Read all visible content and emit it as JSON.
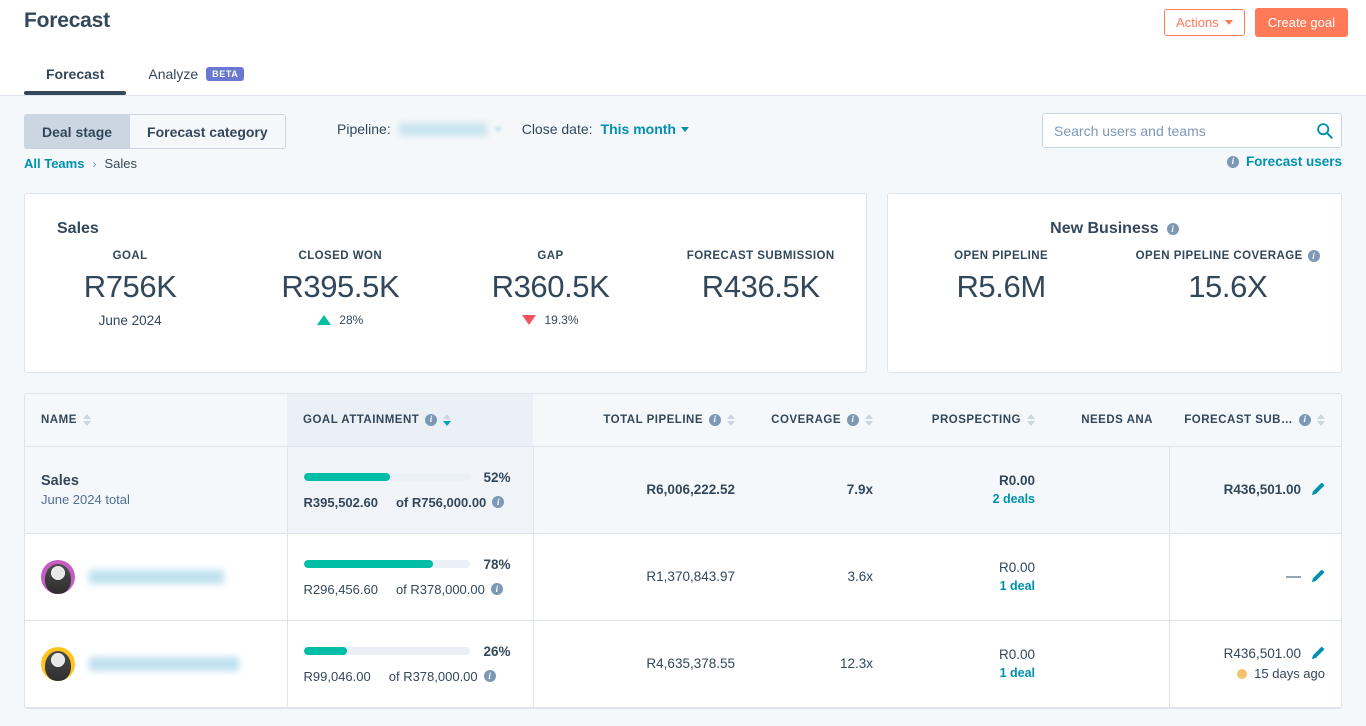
{
  "header": {
    "title": "Forecast",
    "actions_label": "Actions",
    "create_goal_label": "Create goal"
  },
  "tabs": [
    {
      "label": "Forecast",
      "active": true,
      "badge": null
    },
    {
      "label": "Analyze",
      "active": false,
      "badge": "BETA"
    }
  ],
  "filterbar": {
    "segments": [
      {
        "label": "Deal stage",
        "active": true
      },
      {
        "label": "Forecast category",
        "active": false
      }
    ],
    "pipeline_label": "Pipeline:",
    "pipeline_value": "",
    "close_date_label": "Close date:",
    "close_date_value": "This month",
    "search_placeholder": "Search users and teams",
    "search_value": ""
  },
  "breadcrumb": {
    "root": "All Teams",
    "separator": "›",
    "current": "Sales",
    "forecast_users_label": "Forecast users"
  },
  "cards": [
    {
      "title": "Sales",
      "has_info": false,
      "metrics": [
        {
          "label": "GOAL",
          "value": "R756K",
          "sub": "June 2024",
          "delta": null,
          "trend": null,
          "info": false
        },
        {
          "label": "CLOSED WON",
          "value": "R395.5K",
          "sub": null,
          "delta": "28%",
          "trend": "up",
          "info": false
        },
        {
          "label": "GAP",
          "value": "R360.5K",
          "sub": null,
          "delta": "19.3%",
          "trend": "down",
          "info": false
        },
        {
          "label": "FORECAST SUBMISSION",
          "value": "R436.5K",
          "sub": null,
          "delta": null,
          "trend": null,
          "info": false
        }
      ]
    },
    {
      "title": "New Business",
      "has_info": true,
      "metrics": [
        {
          "label": "OPEN PIPELINE",
          "value": "R5.6M",
          "sub": null,
          "delta": null,
          "trend": null,
          "info": false
        },
        {
          "label": "OPEN PIPELINE COVERAGE",
          "value": "15.6X",
          "sub": null,
          "delta": null,
          "trend": null,
          "info": true
        }
      ]
    }
  ],
  "table": {
    "columns": [
      {
        "key": "name",
        "label": "NAME",
        "info": false,
        "sorted": false
      },
      {
        "key": "attainment",
        "label": "GOAL ATTAINMENT",
        "info": true,
        "sorted": true
      },
      {
        "key": "total_pipeline",
        "label": "TOTAL PIPELINE",
        "info": true,
        "sorted": false
      },
      {
        "key": "coverage",
        "label": "COVERAGE",
        "info": true,
        "sorted": false
      },
      {
        "key": "prospecting",
        "label": "PROSPECTING",
        "info": false,
        "sorted": false
      },
      {
        "key": "needs_analysis",
        "label": "NEEDS ANA",
        "info": false,
        "sorted": false
      },
      {
        "key": "forecast_submission",
        "label": "FORECAST SUB…",
        "info": true,
        "sorted": false
      }
    ],
    "rows": [
      {
        "is_total": true,
        "name": "Sales",
        "name_sub": "June 2024 total",
        "avatar": null,
        "attainment_pct": "52%",
        "attainment_fill": 52,
        "attainment_actual": "R395,502.60",
        "attainment_goal": "of R756,000.00",
        "total_pipeline": "R6,006,222.52",
        "coverage": "7.9x",
        "prospecting": "R0.00",
        "prospecting_deals": "2 deals",
        "needs_analysis": "",
        "forecast_submission": "R436,501.00",
        "forecast_sub_note": null,
        "forecast_dash": false
      },
      {
        "is_total": false,
        "name": "",
        "name_sub": null,
        "avatar": "pink",
        "attainment_pct": "78%",
        "attainment_fill": 78,
        "attainment_actual": "R296,456.60",
        "attainment_goal": "of R378,000.00",
        "total_pipeline": "R1,370,843.97",
        "coverage": "3.6x",
        "prospecting": "R0.00",
        "prospecting_deals": "1 deal",
        "needs_analysis": "",
        "forecast_submission": "",
        "forecast_sub_note": null,
        "forecast_dash": true
      },
      {
        "is_total": false,
        "name": "",
        "name_sub": null,
        "avatar": "yellow",
        "attainment_pct": "26%",
        "attainment_fill": 26,
        "attainment_actual": "R99,046.00",
        "attainment_goal": "of R378,000.00",
        "total_pipeline": "R4,635,378.55",
        "coverage": "12.3x",
        "prospecting": "R0.00",
        "prospecting_deals": "1 deal",
        "needs_analysis": "",
        "forecast_submission": "R436,501.00",
        "forecast_sub_note": "15 days ago",
        "forecast_dash": false
      }
    ]
  },
  "colors": {
    "brand_orange": "#ff7a59",
    "teal": "#00bda5",
    "link": "#0091ae",
    "red": "#f2545b",
    "beta_purple": "#6a78d1",
    "text": "#33475b"
  },
  "icons": {
    "search": "search-icon",
    "pencil": "pencil-icon",
    "info": "info-icon"
  }
}
